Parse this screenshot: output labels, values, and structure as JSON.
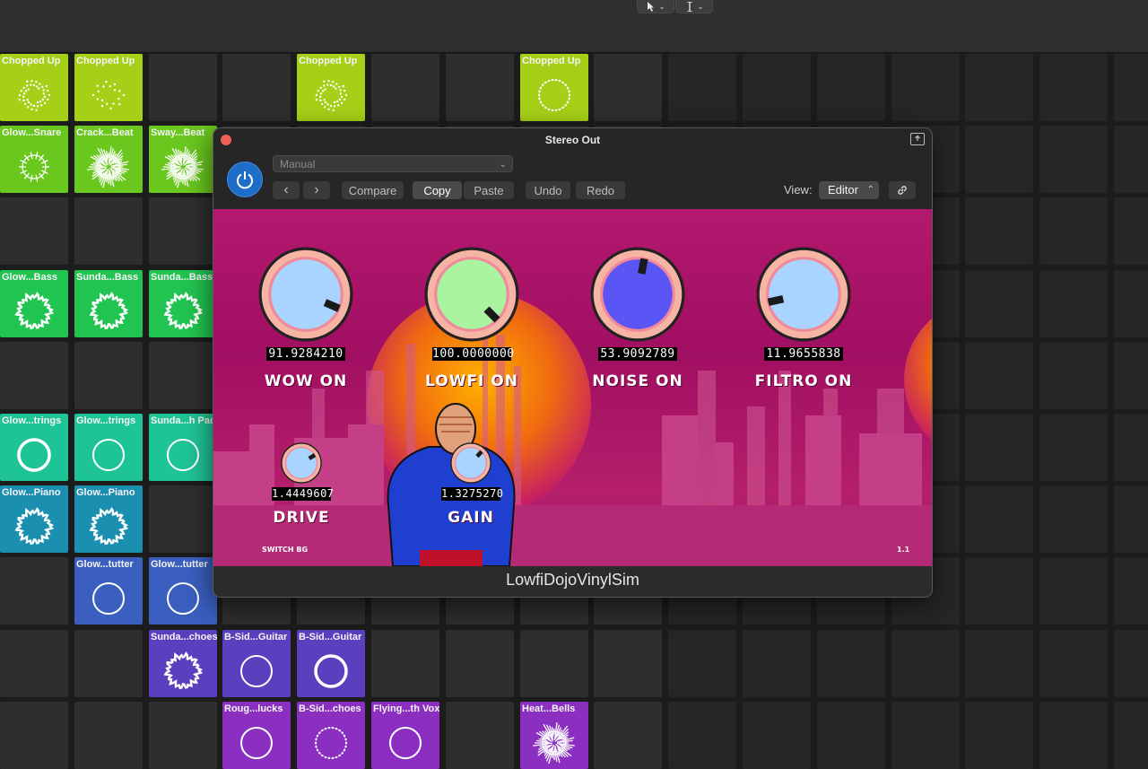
{
  "toolbar": {
    "pointer_tool": "pointer-tool-icon",
    "text_tool": "text-cursor-icon"
  },
  "clips": [
    {
      "label": "Chopped Up",
      "col": 0,
      "row": 0,
      "color": "#a6cf17",
      "viz": "dots"
    },
    {
      "label": "Chopped Up",
      "col": 1,
      "row": 0,
      "color": "#a6cf17",
      "viz": "sparse"
    },
    {
      "label": "Chopped Up",
      "col": 4,
      "row": 0,
      "color": "#a6cf17",
      "viz": "dots"
    },
    {
      "label": "Chopped Up",
      "col": 7,
      "row": 0,
      "color": "#a6cf17",
      "viz": "ring-dots"
    },
    {
      "label": "Glow...Snare",
      "col": 0,
      "row": 1,
      "color": "#6ac71e",
      "viz": "spikes"
    },
    {
      "label": "Crack...Beat",
      "col": 1,
      "row": 1,
      "color": "#6ac71e",
      "viz": "burst"
    },
    {
      "label": "Sway...Beat",
      "col": 2,
      "row": 1,
      "color": "#6ac71e",
      "viz": "burst"
    },
    {
      "label": "Glow...Bass",
      "col": 0,
      "row": 3,
      "color": "#21c450",
      "viz": "wave"
    },
    {
      "label": "Sunda...Bass",
      "col": 1,
      "row": 3,
      "color": "#21c450",
      "viz": "wave"
    },
    {
      "label": "Sunda...Bass",
      "col": 2,
      "row": 3,
      "color": "#21c450",
      "viz": "wave"
    },
    {
      "label": "Glow...trings",
      "col": 0,
      "row": 5,
      "color": "#1fc496",
      "viz": "thick"
    },
    {
      "label": "Glow...trings",
      "col": 1,
      "row": 5,
      "color": "#1fc496",
      "viz": "ring"
    },
    {
      "label": "Sunda...h Pad",
      "col": 2,
      "row": 5,
      "color": "#1fc496",
      "viz": "ring"
    },
    {
      "label": "Glow...Piano",
      "col": 0,
      "row": 6,
      "color": "#1a8fb0",
      "viz": "wave"
    },
    {
      "label": "Glow...Piano",
      "col": 1,
      "row": 6,
      "color": "#1a8fb0",
      "viz": "wave"
    },
    {
      "label": "Glow...tutter",
      "col": 1,
      "row": 7,
      "color": "#3a5fbf",
      "viz": "ring"
    },
    {
      "label": "Glow...tutter",
      "col": 2,
      "row": 7,
      "color": "#3a5fbf",
      "viz": "ring"
    },
    {
      "label": "Sunda...choes",
      "col": 2,
      "row": 8,
      "color": "#5a3fbf",
      "viz": "wave"
    },
    {
      "label": "B-Sid...Guitar",
      "col": 3,
      "row": 8,
      "color": "#5a3fbf",
      "viz": "ring"
    },
    {
      "label": "B-Sid...Guitar",
      "col": 4,
      "row": 8,
      "color": "#5a3fbf",
      "viz": "thick"
    },
    {
      "label": "Roug...lucks",
      "col": 3,
      "row": 9,
      "color": "#8a2fc0",
      "viz": "ring"
    },
    {
      "label": "B-Sid...choes",
      "col": 4,
      "row": 9,
      "color": "#8a2fc0",
      "viz": "ring-dots"
    },
    {
      "label": "Flying...th Vox",
      "col": 5,
      "row": 9,
      "color": "#8a2fc0",
      "viz": "ring"
    },
    {
      "label": "Heat...Bells",
      "col": 7,
      "row": 9,
      "color": "#8a2fc0",
      "viz": "burst"
    }
  ],
  "plugin": {
    "title": "Stereo Out",
    "preset": "Manual",
    "buttons": {
      "prev": "‹",
      "next": "›",
      "compare": "Compare",
      "copy": "Copy",
      "paste": "Paste",
      "undo": "Undo",
      "redo": "Redo"
    },
    "view_label": "View:",
    "view_value": "Editor",
    "footer": "LowfiDojoVinylSim",
    "knobs": [
      {
        "name": "WOW ON",
        "value": "91.9284210",
        "level": 0.919,
        "face": "#a8d4ff"
      },
      {
        "name": "LOWFI ON",
        "value": "100.0000000",
        "level": 1.0,
        "face": "#a9f3a1"
      },
      {
        "name": "NOISE ON",
        "value": "53.9092789",
        "level": 0.539,
        "face": "#5a55f5"
      },
      {
        "name": "FILTRO ON",
        "value": "11.9655838",
        "level": 0.12,
        "face": "#a8d4ff"
      }
    ],
    "small_knobs": [
      {
        "name": "DRIVE",
        "value": "1.4449607",
        "level": 0.72,
        "face": "#a8d4ff"
      },
      {
        "name": "GAIN",
        "value": "1.3275270",
        "level": 0.66,
        "face": "#a8d4ff"
      }
    ],
    "switch_bg": "SWITCH BG",
    "version": "1.1",
    "colors": {
      "accent": "#1c6ec8",
      "art_bg": "#b3186e",
      "knob_ring": "#f6b4a4"
    }
  }
}
